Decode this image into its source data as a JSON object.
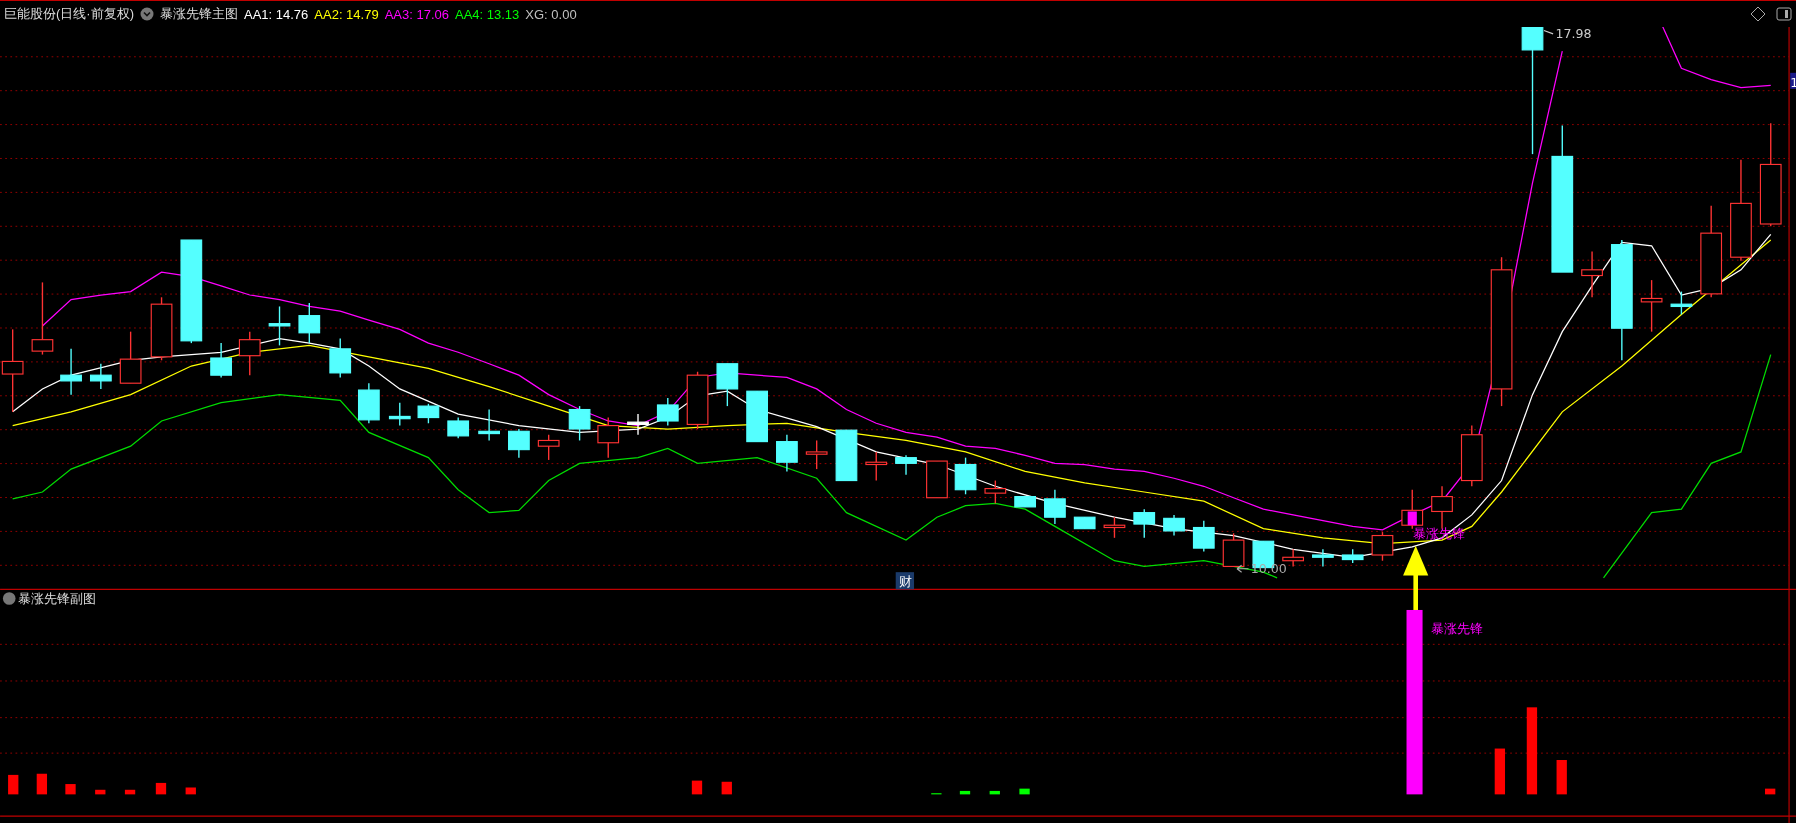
{
  "header": {
    "stock": "巨能股份(日线·前复权)",
    "indicator": "暴涨先锋主图",
    "values": [
      {
        "label": "AA1: 14.76",
        "color": "#ffffff"
      },
      {
        "label": "AA2: 14.79",
        "color": "#ffff00"
      },
      {
        "label": "AA3: 17.06",
        "color": "#ff00ff"
      },
      {
        "label": "AA4: 13.13",
        "color": "#00ff00"
      },
      {
        "label": "XG: 0.00",
        "color": "#c0c0c0"
      }
    ]
  },
  "main_chart": {
    "high_marker": "17.98",
    "low_marker": "10.00",
    "signal_label": "暴涨先锋",
    "event_badge": "财",
    "price_tag": "1"
  },
  "sub_chart": {
    "title": "暴涨先锋副图",
    "signal_label": "暴涨先锋"
  }
}
